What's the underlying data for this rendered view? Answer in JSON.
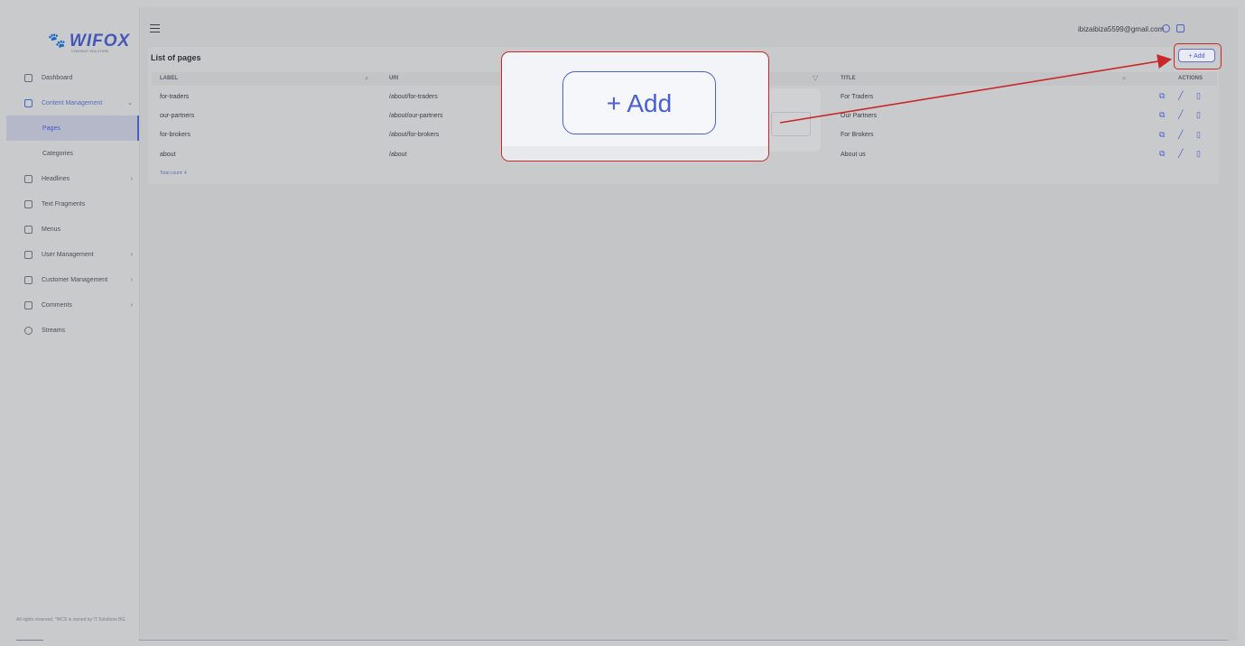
{
  "brand": {
    "name": "WIFOX",
    "tagline": "CONTENT SOLUTION"
  },
  "sidebar": {
    "items": [
      {
        "label": "Dashboard"
      },
      {
        "label": "Content Management",
        "chevron": "⌄"
      },
      {
        "label": "Headlines",
        "chevron": "›"
      },
      {
        "label": "Text Fragments"
      },
      {
        "label": "Menus"
      },
      {
        "label": "User Management",
        "chevron": "›"
      },
      {
        "label": "Customer Management",
        "chevron": "›"
      },
      {
        "label": "Comments",
        "chevron": "›"
      },
      {
        "label": "Streams"
      }
    ],
    "subitems": [
      {
        "label": "Pages"
      },
      {
        "label": "Categories"
      }
    ],
    "footer": "All rights reserved. \"WCS is owned by IT Solutions BG."
  },
  "topbar": {
    "user_email": "ibizaibiza5599@gmail.com"
  },
  "page": {
    "title": "List of pages",
    "add_label": "+ Add",
    "columns": {
      "label": "LABEL",
      "uri": "URI",
      "title": "TITLE",
      "actions": "ACTIONS"
    },
    "rows": [
      {
        "label": "for-traders",
        "uri": "/about/for-traders",
        "title": "For Traders"
      },
      {
        "label": "our-partners",
        "uri": "/about/our-partners",
        "title": "Our Partners"
      },
      {
        "label": "for-brokers",
        "uri": "/about/for-brokers",
        "title": "For Brokers"
      },
      {
        "label": "about",
        "uri": "/about",
        "title": "About us"
      }
    ],
    "total_count": "Total count: 4"
  },
  "callout": {
    "add_label": "+  Add"
  },
  "colors": {
    "accent": "#4b61cc",
    "highlight": "#c8282a"
  }
}
